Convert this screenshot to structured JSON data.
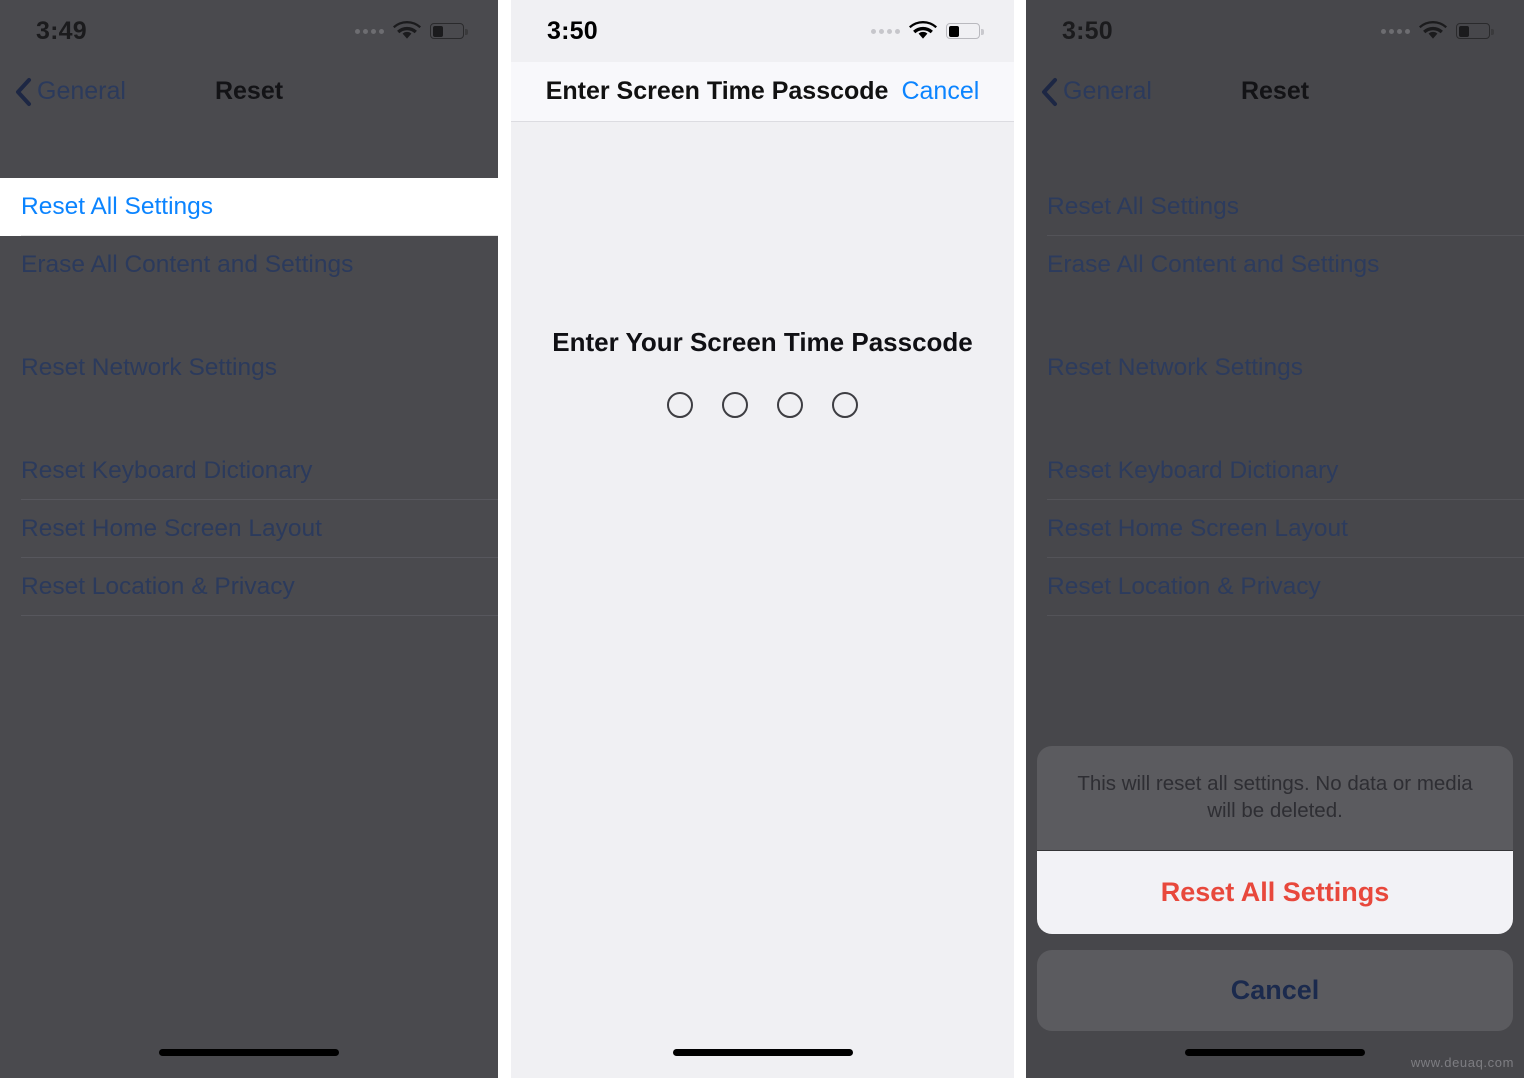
{
  "panels": [
    {
      "id": "reset-list-dimmed",
      "status_bar": {
        "time": "3:49",
        "wifi": "wifi-icon",
        "battery": "battery-low-icon",
        "signal": "signal-dots-icon"
      },
      "nav": {
        "back_label": "General",
        "title": "Reset",
        "back_icon": "chevron-left-icon"
      },
      "rows": [
        {
          "label": "Reset All Settings",
          "highlighted": true
        },
        {
          "label": "Erase All Content and Settings",
          "highlighted": false
        },
        {
          "label": "Reset Network Settings",
          "highlighted": false
        },
        {
          "label": "Reset Keyboard Dictionary",
          "highlighted": false
        },
        {
          "label": "Reset Home Screen Layout",
          "highlighted": false
        },
        {
          "label": "Reset Location & Privacy",
          "highlighted": false
        }
      ]
    },
    {
      "id": "screen-time-passcode",
      "status_bar": {
        "time": "3:50",
        "wifi": "wifi-icon",
        "battery": "battery-low-icon",
        "signal": "signal-dots-icon"
      },
      "nav": {
        "title": "Enter Screen Time Passcode",
        "cancel_label": "Cancel"
      },
      "prompt": "Enter Your Screen Time Passcode",
      "passcode_dots": 4,
      "passcode_filled": 0
    },
    {
      "id": "reset-confirm-sheet",
      "status_bar": {
        "time": "3:50",
        "wifi": "wifi-icon",
        "battery": "battery-low-icon",
        "signal": "signal-dots-icon"
      },
      "nav": {
        "back_label": "General",
        "title": "Reset",
        "back_icon": "chevron-left-icon"
      },
      "rows": [
        {
          "label": "Reset All Settings"
        },
        {
          "label": "Erase All Content and Settings"
        },
        {
          "label": "Reset Network Settings"
        },
        {
          "label": "Reset Keyboard Dictionary"
        },
        {
          "label": "Reset Home Screen Layout"
        },
        {
          "label": "Reset Location & Privacy"
        }
      ],
      "action_sheet": {
        "message": "This will reset all settings. No data or media will be deleted.",
        "destructive_label": "Reset All Settings",
        "cancel_label": "Cancel"
      }
    }
  ],
  "watermark": "www.deuaq.com",
  "colors": {
    "accent_blue": "#0b84ff",
    "dimmed_blue": "#2b3a5c",
    "destructive_red": "#e8483c",
    "dim_backdrop": "#4a4a4e",
    "sheet_surface": "#5b5b5f",
    "light_bg": "#f0f0f3"
  }
}
